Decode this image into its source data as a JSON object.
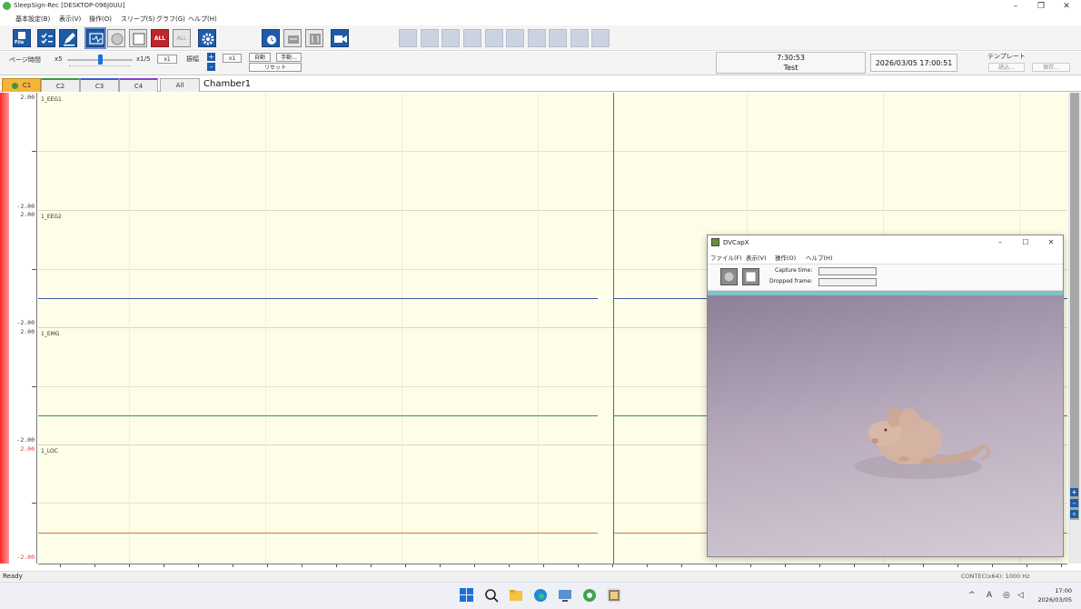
{
  "window": {
    "title": "SleepSign-Rec [DESKTOP-096J0UU]",
    "controls": [
      "–",
      "❐",
      "✕"
    ]
  },
  "menu": [
    "基本設定(B)",
    "表示(V)",
    "操作(O)",
    "スリープ(S)",
    "グラフ(G)",
    "ヘルプ(H)"
  ],
  "toolbar": {
    "file_label": "File",
    "all_label": "ALL",
    "all2_label": "ALL"
  },
  "controls": {
    "page_time_label": "ページ時間",
    "x5": "x5",
    "x1_5": "x1/5",
    "x1_btn": "x1",
    "amplitude_label": "振幅",
    "amp_x1": "x1",
    "auto_btn": "自動",
    "manual_btn": "手動...",
    "reset_btn": "リセット",
    "plus": "+",
    "minus": "–"
  },
  "status_panel": {
    "elapsed": "7:30:53",
    "name": "Test",
    "datetime": "2026/03/05 17:00:51"
  },
  "template": {
    "label": "テンプレート",
    "load": "読込...",
    "save": "保存..."
  },
  "tabs": [
    "C1",
    "C2",
    "C3",
    "C4",
    "All"
  ],
  "chamber": "Chamber1",
  "channels": [
    {
      "name": "1_EEG1",
      "top": "2.00",
      "bottom": "-2.00",
      "color": ""
    },
    {
      "name": "1_EEG2",
      "top": "2.00",
      "bottom": "-2.00",
      "color": "#3b5ba8"
    },
    {
      "name": "1_EMG",
      "top": "2.00",
      "bottom": "-2.00",
      "color": "#3f8f6a"
    },
    {
      "name": "1_LOC",
      "top": "2.00",
      "bottom": "-2.00",
      "color": "#d07a2a"
    }
  ],
  "statusbar": {
    "ready": "Ready",
    "rate": "CONTEC(x64): 1000 Hz"
  },
  "clock": {
    "time": "17:00",
    "date": "2026/03/05"
  },
  "dvcap": {
    "title": "DVCapX",
    "menu": [
      "ファイル(F)",
      "表示(V)",
      "操作(O)",
      "ヘルプ(H)"
    ],
    "capture_time_label": "Capture time:",
    "dropped_frame_label": "Dropped frame:",
    "controls": [
      "–",
      "☐",
      "✕"
    ]
  },
  "colors": {
    "accent": "#1e5ba8",
    "plot_bg": "#fefde8",
    "red_strip": "#ff2a2a"
  }
}
